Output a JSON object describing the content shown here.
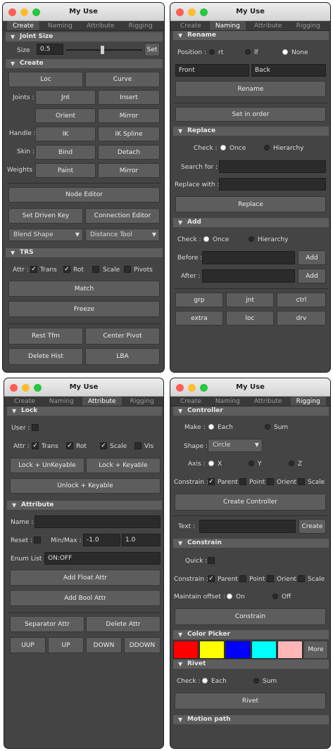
{
  "windows": {
    "title": "My Use",
    "tabs": [
      "Create",
      "Naming",
      "Attribute",
      "Rigging"
    ]
  },
  "create": {
    "joint_size": {
      "header": "Joint Size",
      "label": "Size",
      "value": "0.5",
      "set": "Set",
      "slider_fraction": 0.47
    },
    "create_header": "Create",
    "loc": "Loc",
    "curve": "Curve",
    "joints_label": "Joints :",
    "jnt": "Jnt",
    "insert": "Insert",
    "orient": "Orient",
    "mirror": "Mirror",
    "handle_label": "Handle :",
    "ik": "IK",
    "ik_spline": "IK Spline",
    "skin_label": "Skin :",
    "bind": "Bind",
    "detach": "Detach",
    "weights_label": "Weights :",
    "paint": "Paint",
    "mirror2": "Mirror",
    "node_editor": "Node Editor",
    "set_driven_key": "Set Driven Key",
    "connection_editor": "Connection Editor",
    "blend_shape": "Blend Shape",
    "distance_tool": "Distance Tool",
    "trs_header": "TRS",
    "attr_label": "Attr :",
    "trans": "Trans",
    "rot": "Rot",
    "scale": "Scale",
    "pivots": "Pivots",
    "match": "Match",
    "freeze": "Freeze",
    "rest_tfm": "Rest Tfm",
    "center_pivot": "Center Pivot",
    "delete_hist": "Delete Hist",
    "lba": "LBA"
  },
  "naming": {
    "rename_header": "Rename",
    "position_label": "Position :",
    "rt": "rt",
    "lf": "lf",
    "none": "None",
    "front": "Front",
    "back": "Back",
    "rename": "Rename",
    "set_in_order": "Set in order",
    "replace_header": "Replace",
    "check_label": "Check :",
    "once": "Once",
    "hierarchy": "Hierarchy",
    "search_for": "Search for :",
    "replace_with": "Replace with :",
    "replace": "Replace",
    "add_header": "Add",
    "check2_label": "Check :",
    "once2": "Once",
    "hierarchy2": "Hierarchy",
    "before": "Before :",
    "after": "After :",
    "add1": "Add",
    "add2": "Add",
    "grp": "grp",
    "jnt": "jnt",
    "ctrl": "ctrl",
    "extra": "extra",
    "loc": "loc",
    "drv": "drv"
  },
  "attribute": {
    "lock_header": "Lock",
    "user_label": "User :",
    "attr_label": "Attr :",
    "trans": "Trans",
    "rot": "Rot",
    "scale": "Scale",
    "vis": "Vis",
    "lock_unkeyable": "Lock + UnKeyable",
    "lock_keyable": "Lock + Keyable",
    "unlock_keyable": "Unlock + Keyable",
    "attribute_header": "Attribute",
    "name_label": "Name :",
    "reset_label": "Reset :",
    "minmax_label": "Min/Max :",
    "min": "-1.0",
    "max": "1.0",
    "enum_label": "Enum List :",
    "enum_value": "ON:OFF",
    "add_float": "Add Float Attr",
    "add_bool": "Add Bool Attr",
    "separator_attr": "Separator Attr",
    "delete_attr": "Delete Attr",
    "uup": "UUP",
    "up": "UP",
    "down": "DOWN",
    "ddown": "DDOWN"
  },
  "rigging": {
    "controller_header": "Controller",
    "make_label": "Make :",
    "each": "Each",
    "sum": "Sum",
    "shape_label": "Shape :",
    "shape_value": "Circle",
    "axis_label": "Axis :",
    "x": "X",
    "y": "Y",
    "z": "Z",
    "constrain_label": "Constrain :",
    "parent": "Parent",
    "point": "Point",
    "orient": "Orient",
    "scale": "Scale",
    "create_controller": "Create Controller",
    "text_label": "Text :",
    "create": "Create",
    "constrain_header": "Constrain",
    "quick_label": "Quick :",
    "constrain2_label": "Constrain :",
    "parent2": "Parent",
    "point2": "Point",
    "orient2": "Orient",
    "scale2": "Scale",
    "maintain_label": "Maintain offset :",
    "on": "On",
    "off": "Off",
    "constrain_btn": "Constrain",
    "color_header": "Color Picker",
    "colors": [
      "#ff0000",
      "#ffff00",
      "#0000ff",
      "#00ffff",
      "#ffb6b6"
    ],
    "more": "More",
    "rivet_header": "Rivet",
    "rivet_check_label": "Check :",
    "rivet_each": "Each",
    "rivet_sum": "Sum",
    "rivet_btn": "Rivet",
    "motion_header": "Motion path"
  }
}
